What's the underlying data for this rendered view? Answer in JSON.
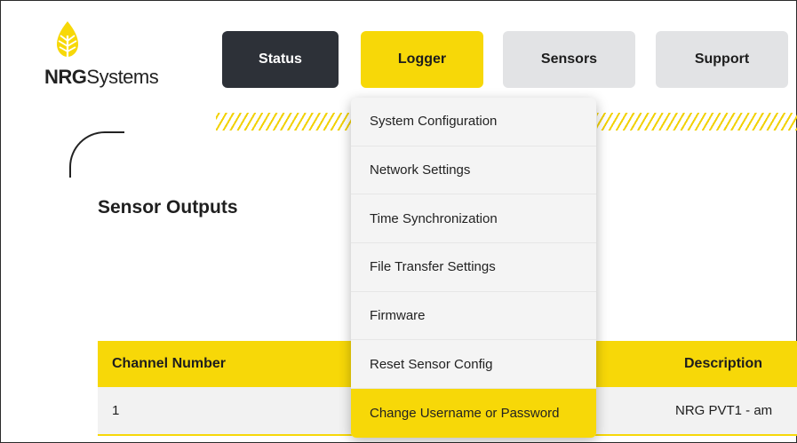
{
  "logo": {
    "bold": "NRG",
    "regular": "Systems"
  },
  "nav": {
    "status": "Status",
    "logger": "Logger",
    "sensors": "Sensors",
    "support": "Support"
  },
  "section_title": "Sensor Outputs",
  "table": {
    "headers": {
      "channel": "Channel Number",
      "description": "Description"
    },
    "rows": [
      {
        "channel": "1",
        "description": "NRG PVT1 - am"
      }
    ]
  },
  "dropdown": {
    "items": [
      "System Configuration",
      "Network Settings",
      "Time Synchronization",
      "File Transfer Settings",
      "Firmware",
      "Reset Sensor Config",
      "Change Username or Password"
    ],
    "highlighted": "Change Username or Password"
  },
  "colors": {
    "brand_yellow": "#f7d808",
    "dark": "#2d3138",
    "light_gray": "#e2e3e5"
  }
}
